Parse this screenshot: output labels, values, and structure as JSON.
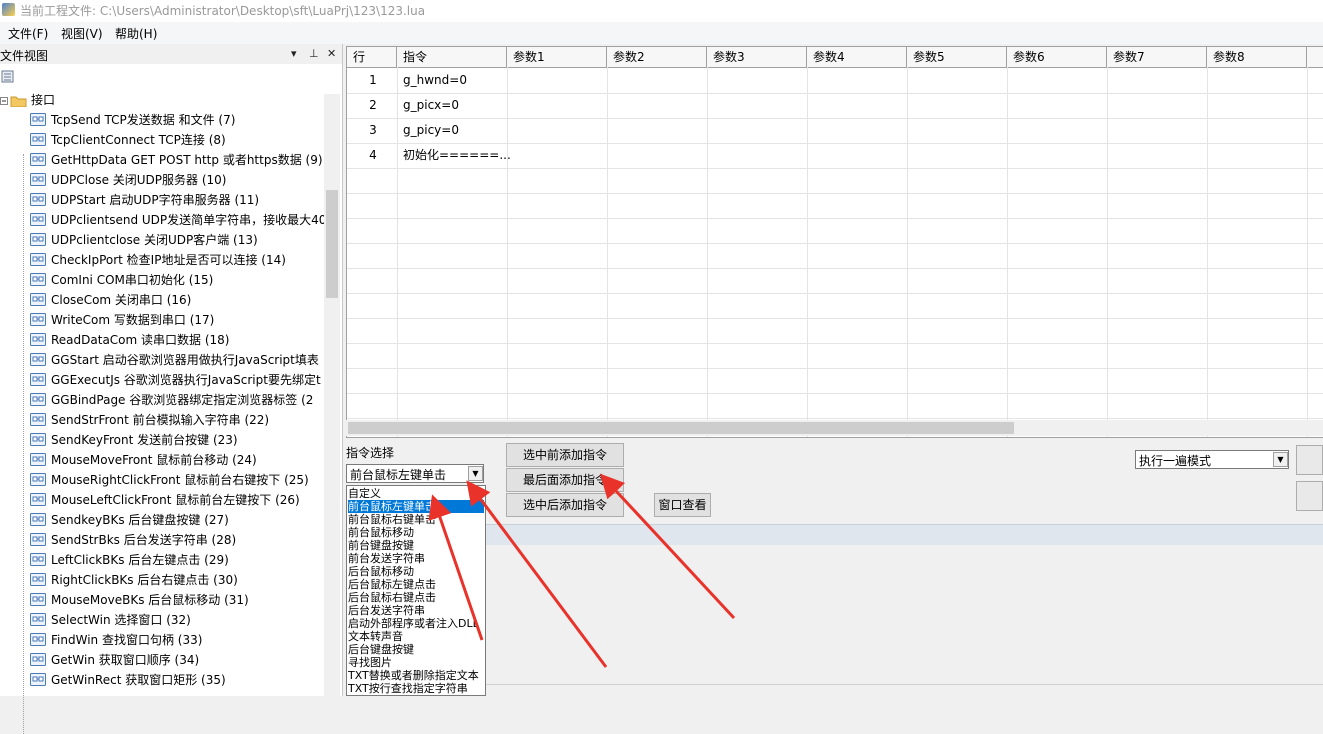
{
  "title_bar": {
    "text": "当前工程文件:  C:\\Users\\Administrator\\Desktop\\sft\\LuaPrj\\123\\123.lua"
  },
  "menu": [
    {
      "label": "文件(F)"
    },
    {
      "label": "视图(V)"
    },
    {
      "label": "帮助(H)"
    }
  ],
  "left_panel": {
    "title": "文件视图",
    "pin_glyph": "▾ ⊥ ✕",
    "root_label": "接口",
    "items": [
      "TcpSend   TCP发送数据 和文件  (7)",
      "TcpClientConnect   TCP连接  (8)",
      "GetHttpData   GET POST http 或者https数据  (9)",
      "UDPClose   关闭UDP服务器  (10)",
      "UDPStart   启动UDP字符串服务器  (11)",
      "UDPclientsend   UDP发送简单字符串，接收最大40",
      "UDPclientclose   关闭UDP客户端  (13)",
      "CheckIpPort   检查IP地址是否可以连接  (14)",
      "ComIni   COM串口初始化  (15)",
      "CloseCom   关闭串口  (16)",
      "WriteCom   写数据到串口  (17)",
      "ReadDataCom   读串口数据  (18)",
      "GGStart   启动谷歌浏览器用做执行JavaScript填表",
      "GGExecutJs   谷歌浏览器执行JavaScript要先绑定t",
      "GGBindPage   谷歌浏览器绑定指定浏览器标签  (2",
      "SendStrFront   前台模拟输入字符串  (22)",
      "SendKeyFront   发送前台按键  (23)",
      "MouseMoveFront   鼠标前台移动  (24)",
      "MouseRightClickFront   鼠标前台右键按下  (25)",
      "MouseLeftClickFront   鼠标前台左键按下  (26)",
      "SendkeyBKs   后台键盘按键  (27)",
      "SendStrBks   后台发送字符串  (28)",
      "LeftClickBKs   后台左键点击  (29)",
      "RightClickBKs   后台右键点击  (30)",
      "MouseMoveBKs   后台鼠标移动  (31)",
      "SelectWin   选择窗口  (32)",
      "FindWin   查找窗口句柄  (33)",
      "GetWin   获取窗口顺序  (34)",
      "GetWinRect   获取窗口矩形  (35)"
    ]
  },
  "grid": {
    "headers": [
      "行",
      "指令",
      "参数1",
      "参数2",
      "参数3",
      "参数4",
      "参数5",
      "参数6",
      "参数7",
      "参数8"
    ],
    "rows": [
      {
        "num": "1",
        "cmd": "g_hwnd=0"
      },
      {
        "num": "2",
        "cmd": "g_picx=0"
      },
      {
        "num": "3",
        "cmd": "g_picy=0"
      },
      {
        "num": "4",
        "cmd": "初始化======..."
      }
    ]
  },
  "controls": {
    "cmd_select_label": "指令选择",
    "cmd_combo_value": "前台鼠标左键单击",
    "btn_add_before": "选中前添加指令",
    "btn_add_last": "最后面添加指令",
    "btn_add_after": "选中后添加指令",
    "btn_window_view": "窗口查看",
    "mode_combo_value": "执行一遍模式"
  },
  "dropdown": {
    "items": [
      "自定义",
      "前台鼠标左键单击",
      "前台鼠标右键单击",
      "前台鼠标移动",
      "前台键盘按键",
      "前台发送字符串",
      "后台鼠标移动",
      "后台鼠标左键点击",
      "后台鼠标右键点击",
      "后台发送字符串",
      "启动外部程序或者注入DLL",
      "文本转声音",
      "后台键盘按键",
      "寻找图片",
      "TXT替换或者删除指定文本",
      "TXT按行查找指定字符串"
    ],
    "selected_index": 1
  },
  "colors": {
    "selection": "#0078d7",
    "arrow": "#e8322a"
  }
}
